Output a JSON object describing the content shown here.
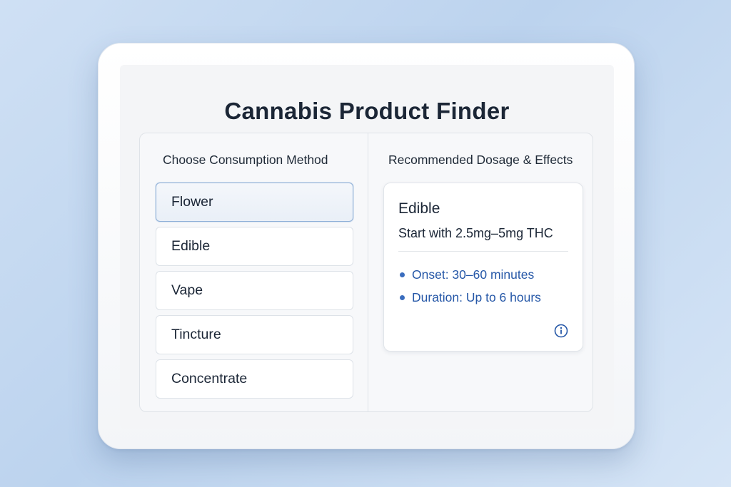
{
  "app": {
    "title": "Cannabis Product Finder"
  },
  "left_column": {
    "heading": "Choose Consumption Method",
    "methods": [
      {
        "label": "Flower",
        "selected": true
      },
      {
        "label": "Edible",
        "selected": false
      },
      {
        "label": "Vape",
        "selected": false
      },
      {
        "label": "Tincture",
        "selected": false
      },
      {
        "label": "Concentrate",
        "selected": false
      }
    ]
  },
  "right_column": {
    "heading": "Recommended Dosage & Effects",
    "card": {
      "title": "Edible",
      "dosage": "Start with 2.5mg–5mg THC",
      "effects": [
        "Onset: 30–60 minutes",
        "Duration: Up to 6 hours"
      ],
      "info_icon": "info-icon"
    }
  },
  "colors": {
    "accent": "#2557a7",
    "selected_border": "#8fb0d8",
    "title_text": "#1b2636"
  }
}
